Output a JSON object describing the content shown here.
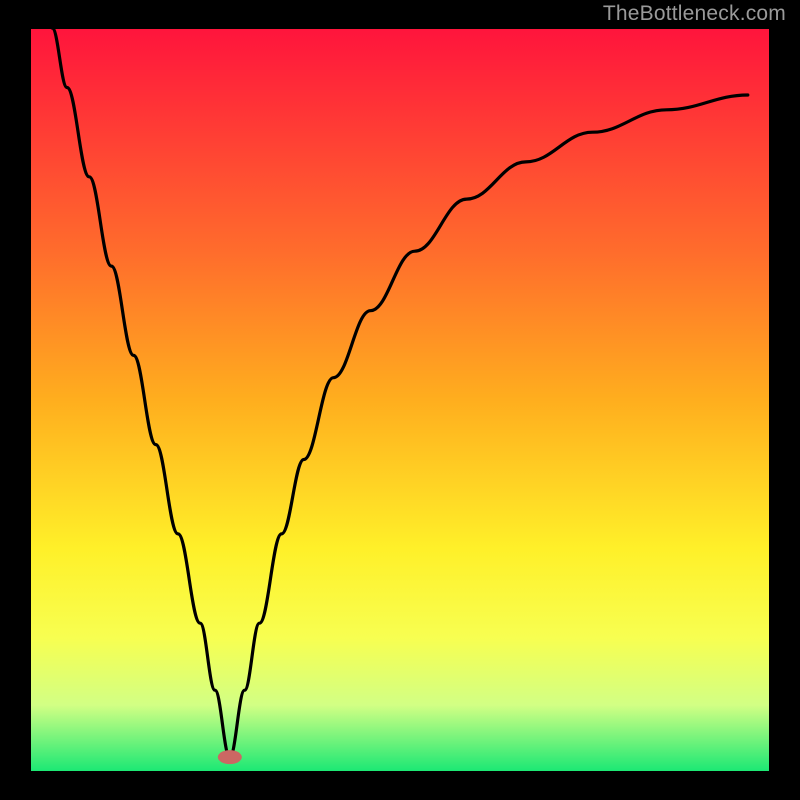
{
  "watermark": {
    "text": "TheBottleneck.com"
  },
  "colors": {
    "top": "#ff143c",
    "mid1": "#ff6c2c",
    "mid2": "#ffae1e",
    "mid3": "#fff029",
    "mid4": "#f7ff51",
    "mid5": "#d2ff84",
    "bottom": "#19e874",
    "curve": "#000000",
    "marker": "#cc6763",
    "frame": "#000000"
  },
  "chart_data": {
    "type": "line",
    "title": "",
    "xlabel": "",
    "ylabel": "",
    "xlim": [
      0,
      100
    ],
    "ylim": [
      0,
      100
    ],
    "note": "Bottleneck-style curve descending from top-left to a minimum near x≈27 then rising with diminishing slope toward top-right. Background is a vertical red→green gradient. Marker sits at the curve minimum.",
    "minimum": {
      "x": 27,
      "y": 2
    },
    "series": [
      {
        "name": "bottleneck-curve",
        "x": [
          3,
          5,
          8,
          11,
          14,
          17,
          20,
          23,
          25,
          27,
          29,
          31,
          34,
          37,
          41,
          46,
          52,
          59,
          67,
          76,
          86,
          97
        ],
        "y": [
          100,
          92,
          80,
          68,
          56,
          44,
          32,
          20,
          11,
          2,
          11,
          20,
          32,
          42,
          53,
          62,
          70,
          77,
          82,
          86,
          89,
          91
        ]
      }
    ]
  }
}
